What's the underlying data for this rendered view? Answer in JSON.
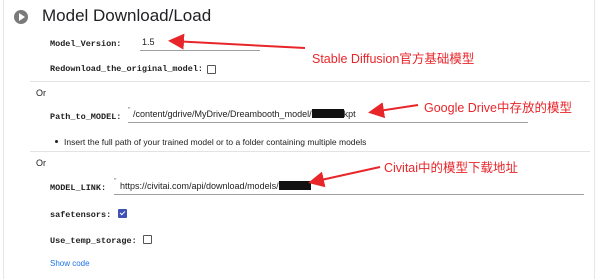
{
  "cell": {
    "title": "Model Download/Load",
    "show_code_label": "Show code"
  },
  "fields": {
    "model_version": {
      "label": "Model_Version:",
      "value": "1.5"
    },
    "redownload": {
      "label": "Redownload_the_original_model:",
      "checked": false
    },
    "or1": "Or",
    "path_to_model": {
      "label": "Path_to_MODEL:",
      "value_prefix": "/content/gdrive/MyDrive/Dreambooth_model/",
      "value_suffix": "kpt"
    },
    "path_hint": "Insert the full path of your trained model or to a folder containing multiple models",
    "or2": "Or",
    "model_link": {
      "label": "MODEL_LINK:",
      "value": "https://civitai.com/api/download/models/"
    },
    "safetensors": {
      "label": "safetensors:",
      "checked": true
    },
    "use_temp_storage": {
      "label": "Use_temp_storage:",
      "checked": false
    }
  },
  "annotations": {
    "a1": "Stable Diffusion官方基础模型",
    "a2": "Google Drive中存放的模型",
    "a3": "Civitai中的模型下载地址",
    "color": "#e8262a"
  },
  "icons": {
    "run": "play-circle-icon",
    "checkbox_checked": "check-icon"
  }
}
